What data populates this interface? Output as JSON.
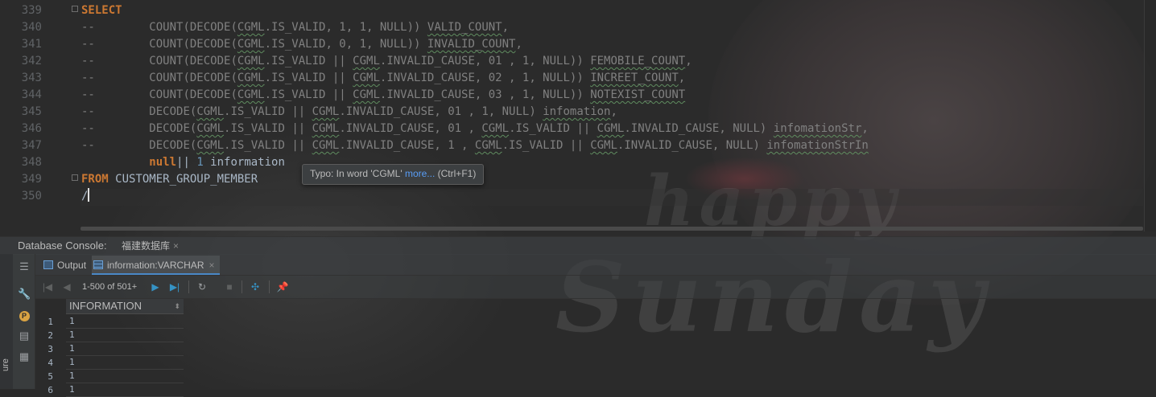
{
  "editor": {
    "lines": [
      {
        "n": "339",
        "segments": [
          {
            "t": "SELECT",
            "c": "kw"
          }
        ]
      },
      {
        "n": "340",
        "segments": [
          {
            "t": "--        ",
            "c": "cmt"
          },
          {
            "t": "COUNT(DECODE(",
            "c": "cmt"
          },
          {
            "t": "CGML",
            "c": "cmt squig"
          },
          {
            "t": ".IS_VALID, 1, 1, NULL)) ",
            "c": "cmt"
          },
          {
            "t": "VALID_COUNT",
            "c": "cmt squig"
          },
          {
            "t": ",",
            "c": "cmt"
          }
        ]
      },
      {
        "n": "341",
        "segments": [
          {
            "t": "--        ",
            "c": "cmt"
          },
          {
            "t": "COUNT(DECODE(",
            "c": "cmt"
          },
          {
            "t": "CGML",
            "c": "cmt squig"
          },
          {
            "t": ".IS_VALID, 0, 1, NULL)) ",
            "c": "cmt"
          },
          {
            "t": "INVALID_COUNT",
            "c": "cmt squig"
          },
          {
            "t": ",",
            "c": "cmt"
          }
        ]
      },
      {
        "n": "342",
        "segments": [
          {
            "t": "--        ",
            "c": "cmt"
          },
          {
            "t": "COUNT(DECODE(",
            "c": "cmt"
          },
          {
            "t": "CGML",
            "c": "cmt squig"
          },
          {
            "t": ".IS_VALID || ",
            "c": "cmt"
          },
          {
            "t": "CGML",
            "c": "cmt squig"
          },
          {
            "t": ".INVALID_CAUSE, 01 , 1, NULL)) ",
            "c": "cmt"
          },
          {
            "t": "FEMOBILE_COUNT",
            "c": "cmt squig"
          },
          {
            "t": ",",
            "c": "cmt"
          }
        ]
      },
      {
        "n": "343",
        "segments": [
          {
            "t": "--        ",
            "c": "cmt"
          },
          {
            "t": "COUNT(DECODE(",
            "c": "cmt"
          },
          {
            "t": "CGML",
            "c": "cmt squig"
          },
          {
            "t": ".IS_VALID || ",
            "c": "cmt"
          },
          {
            "t": "CGML",
            "c": "cmt squig"
          },
          {
            "t": ".INVALID_CAUSE, 02 , 1, NULL)) ",
            "c": "cmt"
          },
          {
            "t": "INCREET_COUNT",
            "c": "cmt squig"
          },
          {
            "t": ",",
            "c": "cmt"
          }
        ]
      },
      {
        "n": "344",
        "segments": [
          {
            "t": "--        ",
            "c": "cmt"
          },
          {
            "t": "COUNT(DECODE(",
            "c": "cmt"
          },
          {
            "t": "CGML",
            "c": "cmt squig"
          },
          {
            "t": ".IS_VALID || ",
            "c": "cmt"
          },
          {
            "t": "CGML",
            "c": "cmt squig"
          },
          {
            "t": ".INVALID_CAUSE, 03 , 1, NULL)) ",
            "c": "cmt"
          },
          {
            "t": "NOTEXIST_COUNT",
            "c": "cmt squig"
          }
        ]
      },
      {
        "n": "345",
        "segments": [
          {
            "t": "--        ",
            "c": "cmt"
          },
          {
            "t": "DECODE(",
            "c": "cmt"
          },
          {
            "t": "CGML",
            "c": "cmt squig"
          },
          {
            "t": ".IS_VALID || ",
            "c": "cmt"
          },
          {
            "t": "CGML",
            "c": "cmt squig"
          },
          {
            "t": ".INVALID_CAUSE, 01 , 1, NULL) ",
            "c": "cmt"
          },
          {
            "t": "infomation",
            "c": "cmt squig"
          },
          {
            "t": ",",
            "c": "cmt"
          }
        ]
      },
      {
        "n": "346",
        "segments": [
          {
            "t": "--        ",
            "c": "cmt"
          },
          {
            "t": "DECODE(",
            "c": "cmt"
          },
          {
            "t": "CGML",
            "c": "cmt squig"
          },
          {
            "t": ".IS_VALID || ",
            "c": "cmt"
          },
          {
            "t": "CGML",
            "c": "cmt squig"
          },
          {
            "t": ".INVALID_CAUSE, 01 , ",
            "c": "cmt"
          },
          {
            "t": "CGML",
            "c": "cmt squig"
          },
          {
            "t": ".IS_VALID || ",
            "c": "cmt"
          },
          {
            "t": "CGML",
            "c": "cmt squig"
          },
          {
            "t": ".INVALID_CAUSE, NULL) ",
            "c": "cmt"
          },
          {
            "t": "infomationStr",
            "c": "cmt squig"
          },
          {
            "t": ",",
            "c": "cmt"
          }
        ]
      },
      {
        "n": "347",
        "segments": [
          {
            "t": "--        ",
            "c": "cmt"
          },
          {
            "t": "DECODE(",
            "c": "cmt"
          },
          {
            "t": "CGML",
            "c": "cmt squig"
          },
          {
            "t": ".IS_VALID || ",
            "c": "cmt"
          },
          {
            "t": "CGML",
            "c": "cmt squig"
          },
          {
            "t": ".INVALID_CAUSE, 1 , ",
            "c": "cmt"
          },
          {
            "t": "CGML",
            "c": "cmt squig"
          },
          {
            "t": ".IS_VALID || ",
            "c": "cmt"
          },
          {
            "t": "CGML",
            "c": "cmt squig"
          },
          {
            "t": ".INVALID_CAUSE, NULL) ",
            "c": "cmt"
          },
          {
            "t": "infomationStrIn",
            "c": "cmt squig"
          }
        ]
      },
      {
        "n": "348",
        "segments": [
          {
            "t": "          ",
            "c": "id"
          },
          {
            "t": "null",
            "c": "kw"
          },
          {
            "t": "|| ",
            "c": "id"
          },
          {
            "t": "1",
            "c": "num"
          },
          {
            "t": " information",
            "c": "id"
          }
        ]
      },
      {
        "n": "349",
        "segments": [
          {
            "t": "FROM",
            "c": "kw"
          },
          {
            "t": " CUSTOMER_GROUP_MEMBER ",
            "c": "id"
          }
        ]
      },
      {
        "n": "350",
        "segments": [
          {
            "t": "/",
            "c": "id"
          }
        ]
      }
    ]
  },
  "tooltip": {
    "text": "Typo: In word 'CGML' ",
    "link": "more...",
    "shortcut": " (Ctrl+F1)"
  },
  "console": {
    "title": "Database Console:",
    "tab_label": "福建数据库",
    "tab_close": "×"
  },
  "results_tabs": [
    {
      "label": "Output",
      "icon": "output-icon"
    },
    {
      "label": "information:VARCHAR",
      "icon": "table-icon",
      "close": "×"
    }
  ],
  "toolbar": {
    "page_info": "1-500 of 501+"
  },
  "grid": {
    "column": "INFORMATION",
    "sort_glyph": "⬍",
    "rows": [
      {
        "n": "1",
        "v": "1"
      },
      {
        "n": "2",
        "v": "1"
      },
      {
        "n": "3",
        "v": "1"
      },
      {
        "n": "4",
        "v": "1"
      },
      {
        "n": "5",
        "v": "1"
      },
      {
        "n": "6",
        "v": "1"
      }
    ]
  },
  "sidebar_vertical_label": "ure",
  "colors": {
    "background": "#2b2b2b",
    "keyword": "#cc7832",
    "comment": "#808080",
    "number": "#6897bb",
    "identifier": "#a9b7c6",
    "link": "#589df6",
    "accent": "#3592c4"
  }
}
